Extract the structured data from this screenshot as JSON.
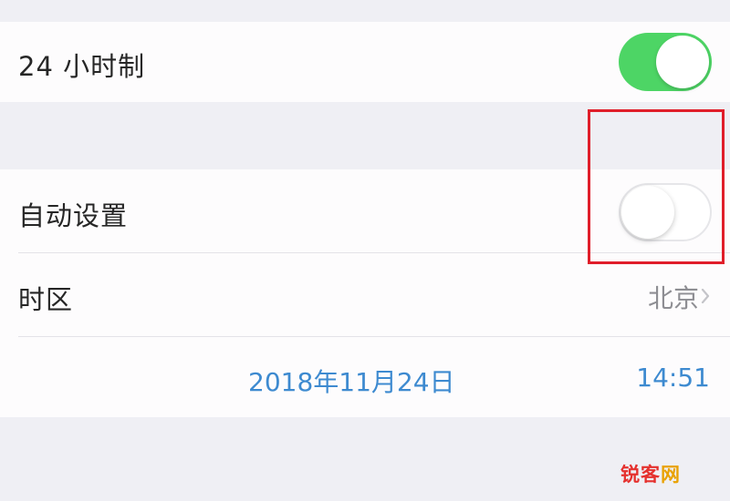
{
  "settings": {
    "hour24": {
      "label": "24 小时制",
      "enabled": true
    },
    "auto_set": {
      "label": "自动设置",
      "enabled": false
    },
    "timezone": {
      "label": "时区",
      "value": "北京"
    },
    "datetime": {
      "date": "2018年11月24日",
      "time": "14:51"
    }
  },
  "icons": {
    "chevron": "chevron-right-icon"
  },
  "colors": {
    "toggle_on": "#4dd565",
    "accent_blue": "#3d8ad0",
    "highlight": "#e01e2a",
    "secondary_text": "#8e8e93"
  },
  "watermark": {
    "part1": "锐客",
    "part2": "网"
  }
}
